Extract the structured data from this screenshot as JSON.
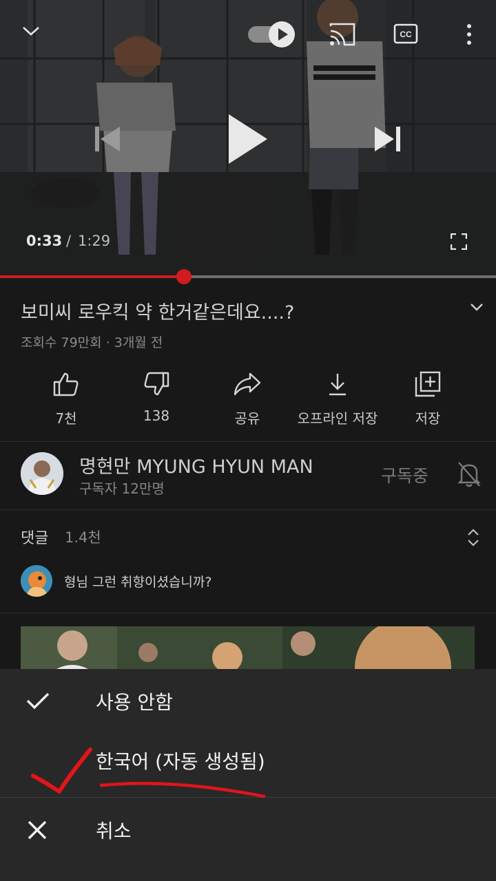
{
  "player": {
    "time_current": "0:33",
    "time_separator": "/",
    "time_total": "1:29",
    "progress_fraction": 0.371
  },
  "video": {
    "title": "보미씨 로우킥 약 한거같은데요....?",
    "meta": "조회수 79만회 · 3개월 전"
  },
  "actions": {
    "like": "7천",
    "dislike": "138",
    "share": "공유",
    "download": "오프라인 저장",
    "save": "저장"
  },
  "channel": {
    "name": "명현만 MYUNG HYUN MAN",
    "subscribers": "구독자 12만명",
    "subscribed_label": "구독중"
  },
  "comments": {
    "title": "댓글",
    "count": "1.4천",
    "top_comment": "형님 그런 취향이셨습니까?"
  },
  "caption_sheet": {
    "options": [
      {
        "label": "사용 안함",
        "selected": true
      },
      {
        "label": "한국어 (자동 생성됨)",
        "selected": false
      }
    ],
    "cancel_label": "취소"
  },
  "colors": {
    "accent": "#d01c1f",
    "background": "#181818",
    "sheet": "#282828",
    "annotation": "#e3141b"
  },
  "icons": [
    "chevron-down-icon",
    "autoplay-toggle-icon",
    "cast-icon",
    "cc-icon",
    "more-vert-icon",
    "previous-icon",
    "play-icon",
    "next-icon",
    "fullscreen-icon",
    "like-icon",
    "dislike-icon",
    "share-icon",
    "download-icon",
    "save-to-playlist-icon",
    "bell-off-icon",
    "sort-icon",
    "check-icon",
    "close-icon"
  ]
}
